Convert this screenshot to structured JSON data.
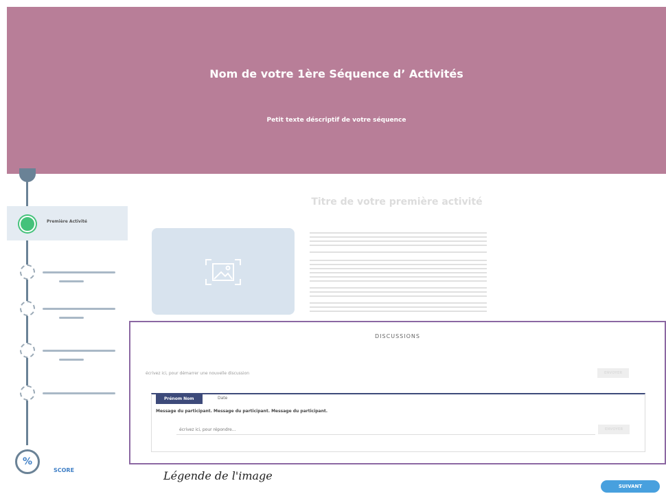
{
  "header": {
    "title": "Nom de votre 1ère Séquence d’ Activités",
    "subtitle": "Petit texte déscriptif de votre séquence"
  },
  "sidebar": {
    "active_item_label": "Première Activité",
    "score_symbol": "%",
    "score_label": "SCORE"
  },
  "activity": {
    "title": "Titre de votre première activité"
  },
  "discussion": {
    "title": "DISCUSSIONS",
    "new_placeholder": "écrivez ici, pour démarrer une nouvelle discussion",
    "send_label": "ENVOYER",
    "thread": {
      "author": "Prénom Nom",
      "date": "Date",
      "message": "Message du participant. Message du participant. Message du participant.",
      "reply_placeholder": "écrivez ici, pour répondre...",
      "reply_send_label": "ENVOYER"
    }
  },
  "caption": "Légende de l'image",
  "next_button": "SUIVANT",
  "colors": {
    "header_bg": "#b87e98",
    "accent_blue": "#48a0de",
    "active_green": "#44c27a",
    "panel_border": "#8b67a2",
    "thread_header": "#3d4a7a"
  }
}
